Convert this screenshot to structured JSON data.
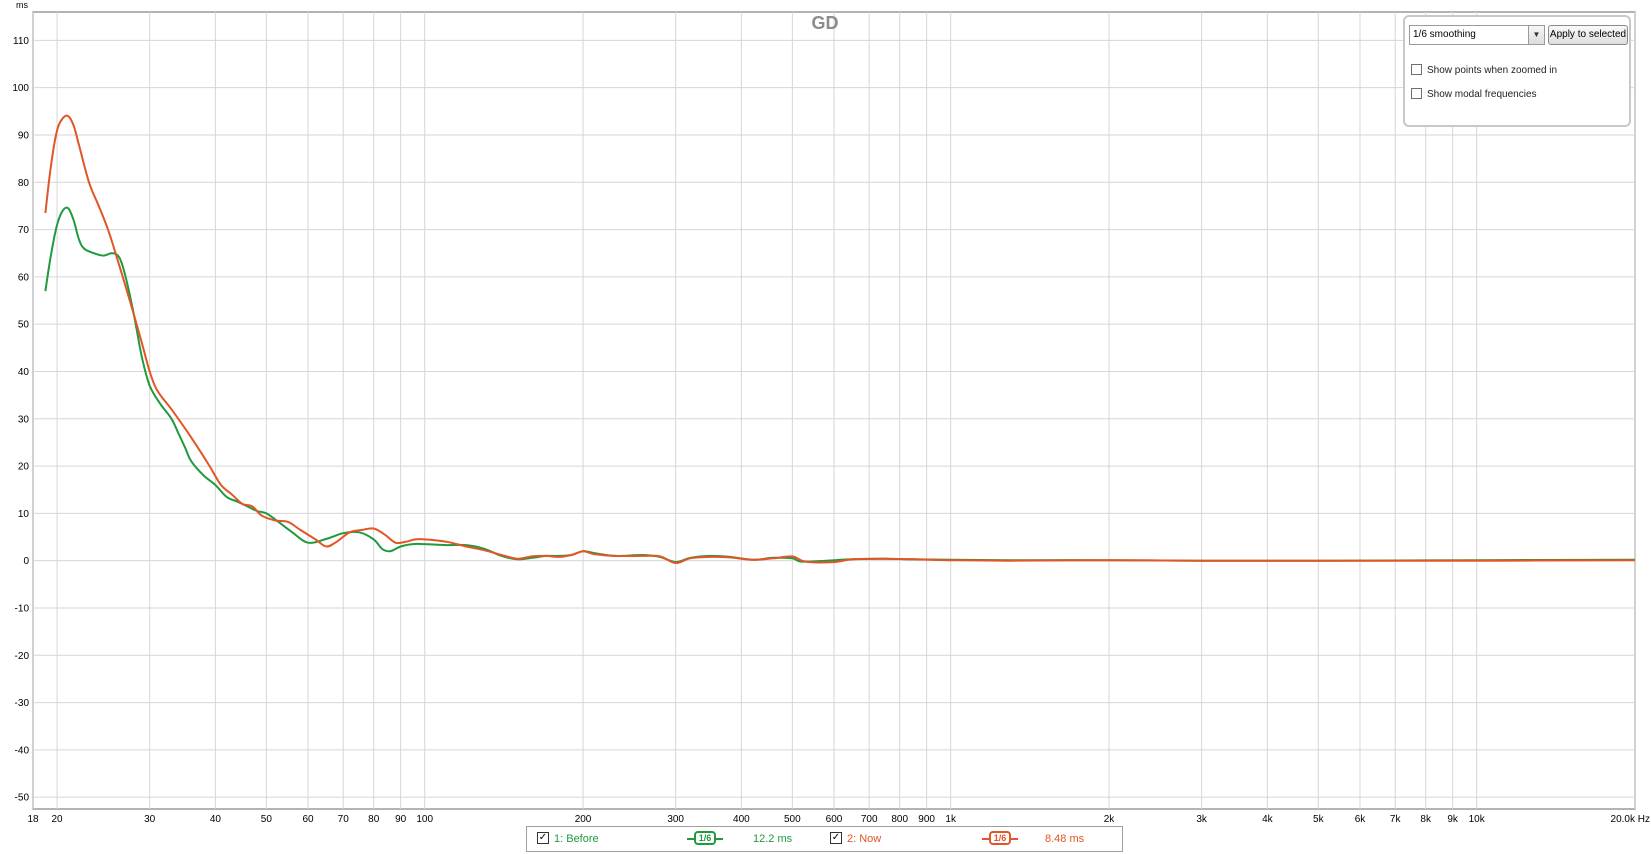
{
  "colors": {
    "before": "#1f9a3e",
    "now": "#e25526"
  },
  "controls": {
    "smoothing_value": "1/6 smoothing",
    "apply_label": "Apply to selected",
    "option_points": "Show points when zoomed in",
    "option_modal": "Show modal frequencies"
  },
  "legend": {
    "items": [
      {
        "label": "1: Before",
        "checked": true,
        "smoothing": "1/6",
        "value": "12.2 ms"
      },
      {
        "label": "2: Now",
        "checked": true,
        "smoothing": "1/6",
        "value": "8.48 ms"
      }
    ]
  },
  "chart_data": {
    "type": "line",
    "title": "GD",
    "ylabel": "ms",
    "xlabel": "Hz",
    "x_scale": "log",
    "xlim": [
      18,
      20000
    ],
    "ylim": [
      -50,
      110
    ],
    "grid": true,
    "ytick_labels": [
      "110",
      "100",
      "90",
      "80",
      "70",
      "60",
      "50",
      "40",
      "30",
      "20",
      "10",
      "0",
      "-10",
      "-20",
      "-30",
      "-40",
      "-50"
    ],
    "xticks": [
      18,
      20,
      30,
      40,
      50,
      60,
      70,
      80,
      90,
      100,
      200,
      300,
      400,
      500,
      600,
      700,
      800,
      900,
      1000,
      2000,
      3000,
      4000,
      5000,
      6000,
      7000,
      8000,
      9000,
      10000,
      20000
    ],
    "xtick_labels": [
      "18",
      "20",
      "30",
      "40",
      "50",
      "60",
      "70",
      "80",
      "90",
      "100",
      "200",
      "300",
      "400",
      "500",
      "600",
      "700",
      "800",
      "900",
      "1k",
      "2k",
      "3k",
      "4k",
      "5k",
      "6k",
      "7k",
      "8k",
      "9k",
      "10k",
      "20.0k Hz"
    ],
    "series": [
      {
        "name": "1: Before",
        "points": [
          [
            19,
            57
          ],
          [
            19.5,
            65
          ],
          [
            20,
            71
          ],
          [
            20.5,
            74
          ],
          [
            21,
            74.5
          ],
          [
            21.5,
            72
          ],
          [
            22,
            68
          ],
          [
            22.5,
            66
          ],
          [
            23.5,
            65
          ],
          [
            24.5,
            64.5
          ],
          [
            25.5,
            65
          ],
          [
            26.3,
            64
          ],
          [
            27,
            60
          ],
          [
            28,
            52
          ],
          [
            29,
            43
          ],
          [
            30,
            37
          ],
          [
            31.5,
            33
          ],
          [
            33,
            30
          ],
          [
            34,
            27
          ],
          [
            35,
            24
          ],
          [
            36,
            21
          ],
          [
            38,
            18
          ],
          [
            40,
            16
          ],
          [
            42,
            13.5
          ],
          [
            44,
            12.5
          ],
          [
            46,
            11.5
          ],
          [
            48,
            10.5
          ],
          [
            50,
            10
          ],
          [
            53,
            8
          ],
          [
            56,
            6
          ],
          [
            60,
            3.8
          ],
          [
            65,
            4.6
          ],
          [
            70,
            5.8
          ],
          [
            75,
            6
          ],
          [
            80,
            4.5
          ],
          [
            83,
            2.5
          ],
          [
            86,
            2
          ],
          [
            90,
            3
          ],
          [
            95,
            3.5
          ],
          [
            100,
            3.5
          ],
          [
            110,
            3.3
          ],
          [
            120,
            3.3
          ],
          [
            130,
            2.5
          ],
          [
            140,
            1
          ],
          [
            150,
            0.3
          ],
          [
            160,
            0.6
          ],
          [
            170,
            1
          ],
          [
            180,
            1
          ],
          [
            190,
            1.2
          ],
          [
            200,
            2
          ],
          [
            210,
            1.6
          ],
          [
            230,
            1
          ],
          [
            260,
            1.2
          ],
          [
            280,
            0.8
          ],
          [
            300,
            -0.3
          ],
          [
            320,
            0.6
          ],
          [
            350,
            1
          ],
          [
            380,
            0.8
          ],
          [
            420,
            0.2
          ],
          [
            460,
            0.6
          ],
          [
            500,
            0.5
          ],
          [
            520,
            -0.2
          ],
          [
            580,
            0
          ],
          [
            650,
            0.3
          ],
          [
            750,
            0.4
          ],
          [
            850,
            0.3
          ],
          [
            1000,
            0.2
          ],
          [
            1300,
            0.1
          ],
          [
            2000,
            0.1
          ],
          [
            3000,
            0
          ],
          [
            5000,
            0
          ],
          [
            10000,
            0.1
          ],
          [
            20000,
            0.2
          ]
        ]
      },
      {
        "name": "2: Now",
        "points": [
          [
            19,
            73.5
          ],
          [
            19.5,
            84
          ],
          [
            20,
            91
          ],
          [
            20.5,
            93.5
          ],
          [
            21,
            94
          ],
          [
            21.5,
            92
          ],
          [
            22,
            88
          ],
          [
            23,
            80
          ],
          [
            24,
            75
          ],
          [
            25,
            70
          ],
          [
            26,
            64
          ],
          [
            27,
            58
          ],
          [
            28,
            52
          ],
          [
            29,
            46
          ],
          [
            30,
            40
          ],
          [
            31,
            36
          ],
          [
            33,
            32
          ],
          [
            35,
            28
          ],
          [
            37,
            24
          ],
          [
            39,
            20
          ],
          [
            41,
            16
          ],
          [
            43,
            14
          ],
          [
            45,
            12
          ],
          [
            47,
            11.5
          ],
          [
            49,
            9.5
          ],
          [
            52,
            8.5
          ],
          [
            55,
            8.2
          ],
          [
            58,
            6.5
          ],
          [
            62,
            4.5
          ],
          [
            65,
            3
          ],
          [
            68,
            4
          ],
          [
            72,
            6
          ],
          [
            76,
            6.5
          ],
          [
            80,
            6.8
          ],
          [
            84,
            5.5
          ],
          [
            88,
            3.8
          ],
          [
            92,
            4
          ],
          [
            96,
            4.5
          ],
          [
            100,
            4.5
          ],
          [
            110,
            4
          ],
          [
            120,
            3
          ],
          [
            130,
            2.2
          ],
          [
            140,
            1.2
          ],
          [
            150,
            0.4
          ],
          [
            160,
            0.9
          ],
          [
            170,
            1
          ],
          [
            180,
            0.8
          ],
          [
            190,
            1.2
          ],
          [
            200,
            2
          ],
          [
            210,
            1.4
          ],
          [
            230,
            1
          ],
          [
            260,
            1
          ],
          [
            280,
            0.9
          ],
          [
            300,
            -0.5
          ],
          [
            320,
            0.5
          ],
          [
            350,
            0.8
          ],
          [
            380,
            0.7
          ],
          [
            420,
            0.2
          ],
          [
            460,
            0.5
          ],
          [
            500,
            0.9
          ],
          [
            530,
            -0.2
          ],
          [
            600,
            -0.3
          ],
          [
            650,
            0.3
          ],
          [
            750,
            0.4
          ],
          [
            850,
            0.3
          ],
          [
            1000,
            0.1
          ],
          [
            1300,
            0
          ],
          [
            2000,
            0.1
          ],
          [
            3000,
            0
          ],
          [
            5000,
            0
          ],
          [
            10000,
            0
          ],
          [
            20000,
            0.1
          ]
        ]
      }
    ]
  }
}
